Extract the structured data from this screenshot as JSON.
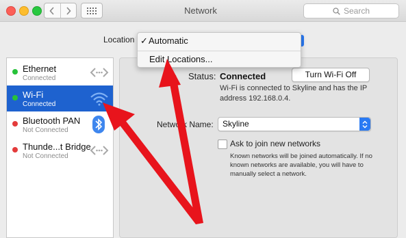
{
  "window": {
    "title": "Network",
    "search_placeholder": "Search"
  },
  "location": {
    "label": "Location",
    "check": "✓",
    "options": [
      "Automatic",
      "Edit Locations..."
    ]
  },
  "services": [
    {
      "name": "Ethernet",
      "status": "Connected",
      "dot": "green",
      "icon": "ethernet-icon"
    },
    {
      "name": "Wi-Fi",
      "status": "Connected",
      "dot": "green",
      "icon": "wifi-icon",
      "selected": true
    },
    {
      "name": "Bluetooth PAN",
      "status": "Not Connected",
      "dot": "red",
      "icon": "bluetooth-icon"
    },
    {
      "name": "Thunde...t Bridge",
      "status": "Not Connected",
      "dot": "red",
      "icon": "thunderbolt-bridge-icon"
    }
  ],
  "detail": {
    "status_label": "Status:",
    "status_value": "Connected",
    "turn_off_button": "Turn Wi-Fi Off",
    "status_description": "Wi-Fi is connected to Skyline and has the IP address 192.168.0.4.",
    "network_name_label": "Network Name:",
    "network_name_value": "Skyline",
    "ask_label": "Ask to join new networks",
    "ask_description": "Known networks will be joined automatically. If no known networks are available, you will have to manually select a network."
  },
  "colors": {
    "selection": "#1e62cf",
    "accent": "#2a7af3",
    "annotation_arrow": "#e8141c",
    "status_green": "#27c23a",
    "status_red": "#e43b3b"
  }
}
